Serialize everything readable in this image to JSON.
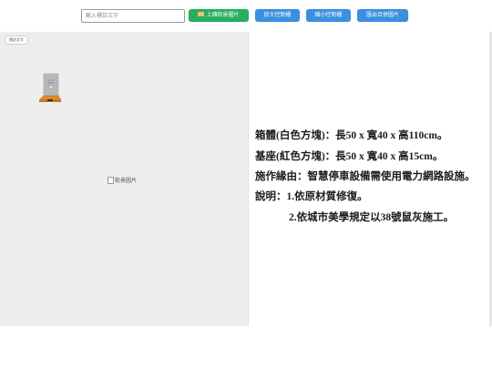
{
  "toolbar": {
    "search_placeholder": "輸入標註文字",
    "upload_button": "上傳街景圖片",
    "zoom_in_button": "放大控制櫃",
    "zoom_out_button": "縮小控制櫃",
    "export_button": "匯出合併圖片"
  },
  "canvas": {
    "tag_label": "標註文字",
    "background_alt": "街景圖片"
  },
  "description": {
    "line1": "箱體(白色方塊)：長50 x 寬40 x 高110cm。",
    "line2": "基座(紅色方塊)：長50 x 寬40 x 高15cm。",
    "line3": "施作緣由：智慧停車設備需使用電力網路設施。",
    "line4": "說明：1.依原材質修復。",
    "line5": "2.依城市美學規定以38號鼠灰施工。"
  },
  "colors": {
    "green_button": "#27ae60",
    "blue_button": "#3a8fe0",
    "cabinet_body": "#c9c9c9",
    "cabinet_base": "#e08a2e"
  },
  "icons": {
    "upload": "folder-icon",
    "broken_image": "broken-image-icon"
  }
}
